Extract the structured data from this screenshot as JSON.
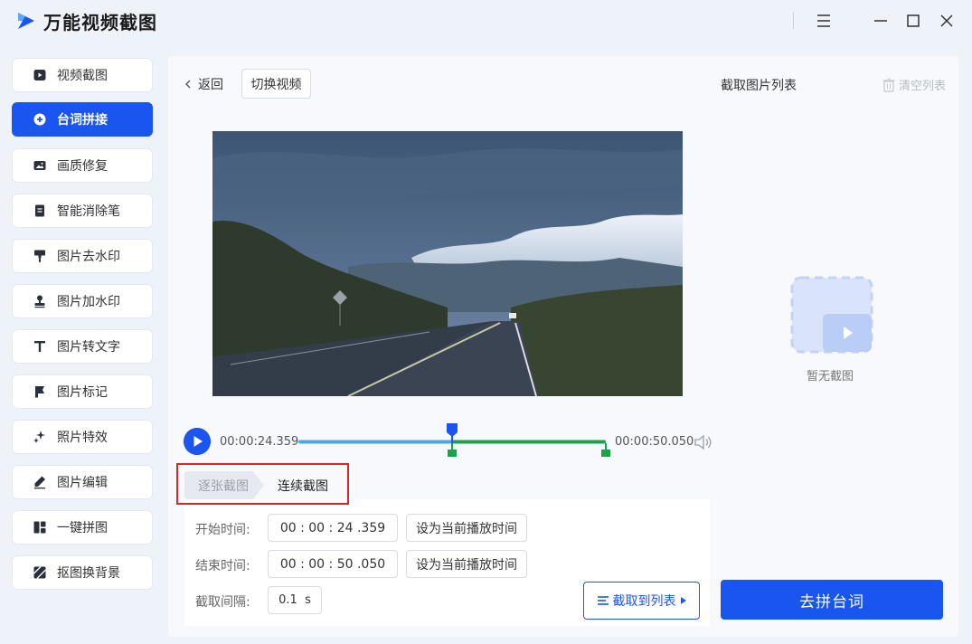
{
  "app": {
    "title": "万能视频截图"
  },
  "colors": {
    "accent": "#1a55f0",
    "range": "#1aa34a",
    "progress": "#4aa8f0",
    "highlight_border": "#e0222b"
  },
  "window_controls": [
    "menu-icon",
    "minimize-icon",
    "maximize-icon",
    "close-icon"
  ],
  "sidebar": {
    "items": [
      {
        "label": "视频截图",
        "icon": "video-capture-icon",
        "active": false
      },
      {
        "label": "台词拼接",
        "icon": "plus-circle-icon",
        "active": true
      },
      {
        "label": "画质修复",
        "icon": "image-icon",
        "active": false
      },
      {
        "label": "智能消除笔",
        "icon": "document-icon",
        "active": false
      },
      {
        "label": "图片去水印",
        "icon": "brush-icon",
        "active": false
      },
      {
        "label": "图片加水印",
        "icon": "stamp-icon",
        "active": false
      },
      {
        "label": "图片转文字",
        "icon": "text-t-icon",
        "active": false
      },
      {
        "label": "图片标记",
        "icon": "flag-icon",
        "active": false
      },
      {
        "label": "照片特效",
        "icon": "sparkle-icon",
        "active": false
      },
      {
        "label": "图片编辑",
        "icon": "pencil-icon",
        "active": false
      },
      {
        "label": "一键拼图",
        "icon": "collage-icon",
        "active": false
      },
      {
        "label": "抠图换背景",
        "icon": "cutout-icon",
        "active": false
      }
    ]
  },
  "toolbar": {
    "back_label": "返回",
    "switch_label": "切换视频"
  },
  "capture_list": {
    "title": "截取图片列表",
    "clear_label": "清空列表",
    "empty_text": "暂无截图"
  },
  "player": {
    "current_time": "00:00:24.359",
    "end_time": "00:00:50.050",
    "playhead_fraction": 0.5,
    "range_start_fraction": 0.5,
    "range_end_fraction": 1.0
  },
  "modes": {
    "single": "逐张截图",
    "continuous": "连续截图",
    "selected": "continuous"
  },
  "settings": {
    "start_label": "开始时间:",
    "start_value": "00 : 00 : 24 .359",
    "end_label": "结束时间:",
    "end_value": "00 : 00 : 50 .050",
    "set_current_label": "设为当前播放时间",
    "interval_label": "截取间隔:",
    "interval_value": "0.1  s"
  },
  "actions": {
    "capture_to_list": "截取到列表",
    "go_splice": "去拼台词"
  }
}
